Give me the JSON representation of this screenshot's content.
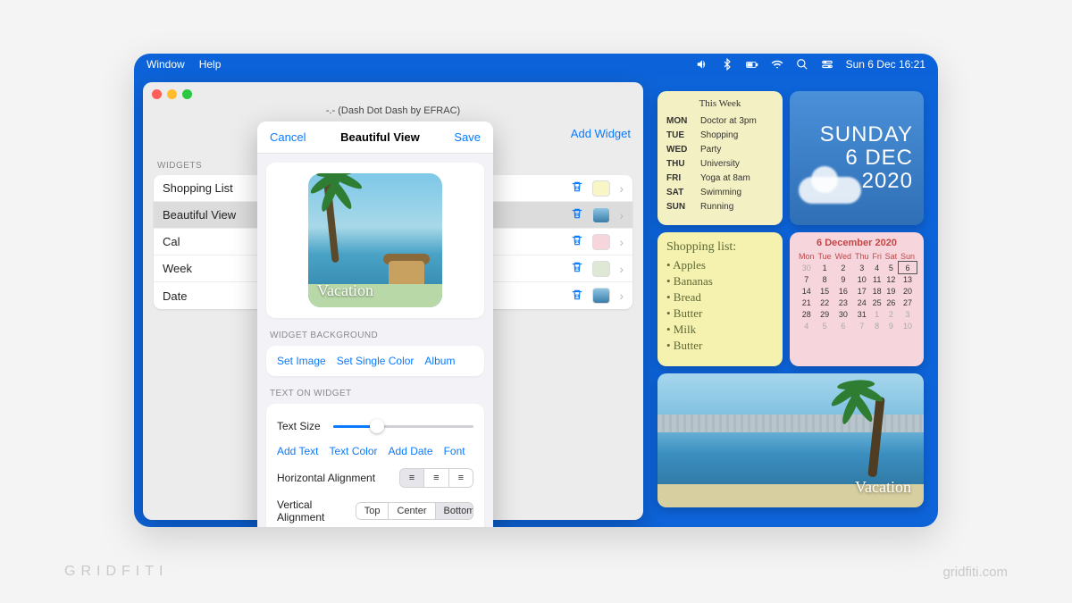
{
  "menubar": {
    "left": [
      "Window",
      "Help"
    ],
    "clock": "Sun 6 Dec  16:21"
  },
  "window": {
    "title": "-.- (Dash Dot Dash by EFRAC)",
    "add_widget": "Add Widget",
    "section_label": "WIDGETS"
  },
  "widget_list": [
    {
      "label": "Shopping List",
      "swatch": "#f8f6c7"
    },
    {
      "label": "Beautiful View",
      "swatch_img": true
    },
    {
      "label": "Cal",
      "swatch": "#f6d5dc"
    },
    {
      "label": "Week",
      "swatch": "#dfe8d4"
    },
    {
      "label": "Date",
      "swatch_img": true
    }
  ],
  "editor": {
    "cancel": "Cancel",
    "title": "Beautiful View",
    "save": "Save",
    "preview_caption": "Vacation",
    "sections": {
      "background_label": "WIDGET BACKGROUND",
      "background_actions": [
        "Set Image",
        "Set Single Color",
        "Album"
      ],
      "text_label": "TEXT ON WIDGET",
      "text_size_label": "Text Size",
      "text_actions": [
        "Add Text",
        "Text Color",
        "Add Date",
        "Font"
      ],
      "halign_label": "Horizontal Alignment",
      "valign_label": "Vertical Alignment",
      "valign_options": [
        "Top",
        "Center",
        "Bottom"
      ]
    }
  },
  "desktop": {
    "week": {
      "title": "This Week",
      "rows": [
        [
          "MON",
          "Doctor at 3pm"
        ],
        [
          "TUE",
          "Shopping"
        ],
        [
          "WED",
          "Party"
        ],
        [
          "THU",
          "University"
        ],
        [
          "FRI",
          "Yoga at 8am"
        ],
        [
          "SAT",
          "Swimming"
        ],
        [
          "SUN",
          "Running"
        ]
      ]
    },
    "date": {
      "line1": "SUNDAY",
      "line2": "6 DEC",
      "line3": "2020"
    },
    "shopping": {
      "title": "Shopping list:",
      "items": [
        "Apples",
        "Bananas",
        "Bread",
        "Butter",
        "Milk",
        "Butter"
      ]
    },
    "calendar": {
      "title": "6 December 2020",
      "dow": [
        "Mon",
        "Tue",
        "Wed",
        "Thu",
        "Fri",
        "Sat",
        "Sun"
      ],
      "weeks": [
        [
          {
            "d": 30,
            "dim": true
          },
          {
            "d": 1
          },
          {
            "d": 2
          },
          {
            "d": 3
          },
          {
            "d": 4
          },
          {
            "d": 5
          },
          {
            "d": 6,
            "today": true
          }
        ],
        [
          {
            "d": 7
          },
          {
            "d": 8
          },
          {
            "d": 9
          },
          {
            "d": 10
          },
          {
            "d": 11
          },
          {
            "d": 12
          },
          {
            "d": 13
          }
        ],
        [
          {
            "d": 14
          },
          {
            "d": 15
          },
          {
            "d": 16
          },
          {
            "d": 17
          },
          {
            "d": 18
          },
          {
            "d": 19
          },
          {
            "d": 20
          }
        ],
        [
          {
            "d": 21
          },
          {
            "d": 22
          },
          {
            "d": 23
          },
          {
            "d": 24
          },
          {
            "d": 25
          },
          {
            "d": 26
          },
          {
            "d": 27
          }
        ],
        [
          {
            "d": 28
          },
          {
            "d": 29
          },
          {
            "d": 30
          },
          {
            "d": 31
          },
          {
            "d": 1,
            "dim": true
          },
          {
            "d": 2,
            "dim": true
          },
          {
            "d": 3,
            "dim": true
          }
        ],
        [
          {
            "d": 4,
            "dim": true
          },
          {
            "d": 5,
            "dim": true
          },
          {
            "d": 6,
            "dim": true
          },
          {
            "d": 7,
            "dim": true
          },
          {
            "d": 8,
            "dim": true
          },
          {
            "d": 9,
            "dim": true
          },
          {
            "d": 10,
            "dim": true
          }
        ]
      ]
    },
    "vacation_caption": "Vacation"
  },
  "brand": {
    "left": "GRIDFITI",
    "right": "gridfiti.com"
  }
}
